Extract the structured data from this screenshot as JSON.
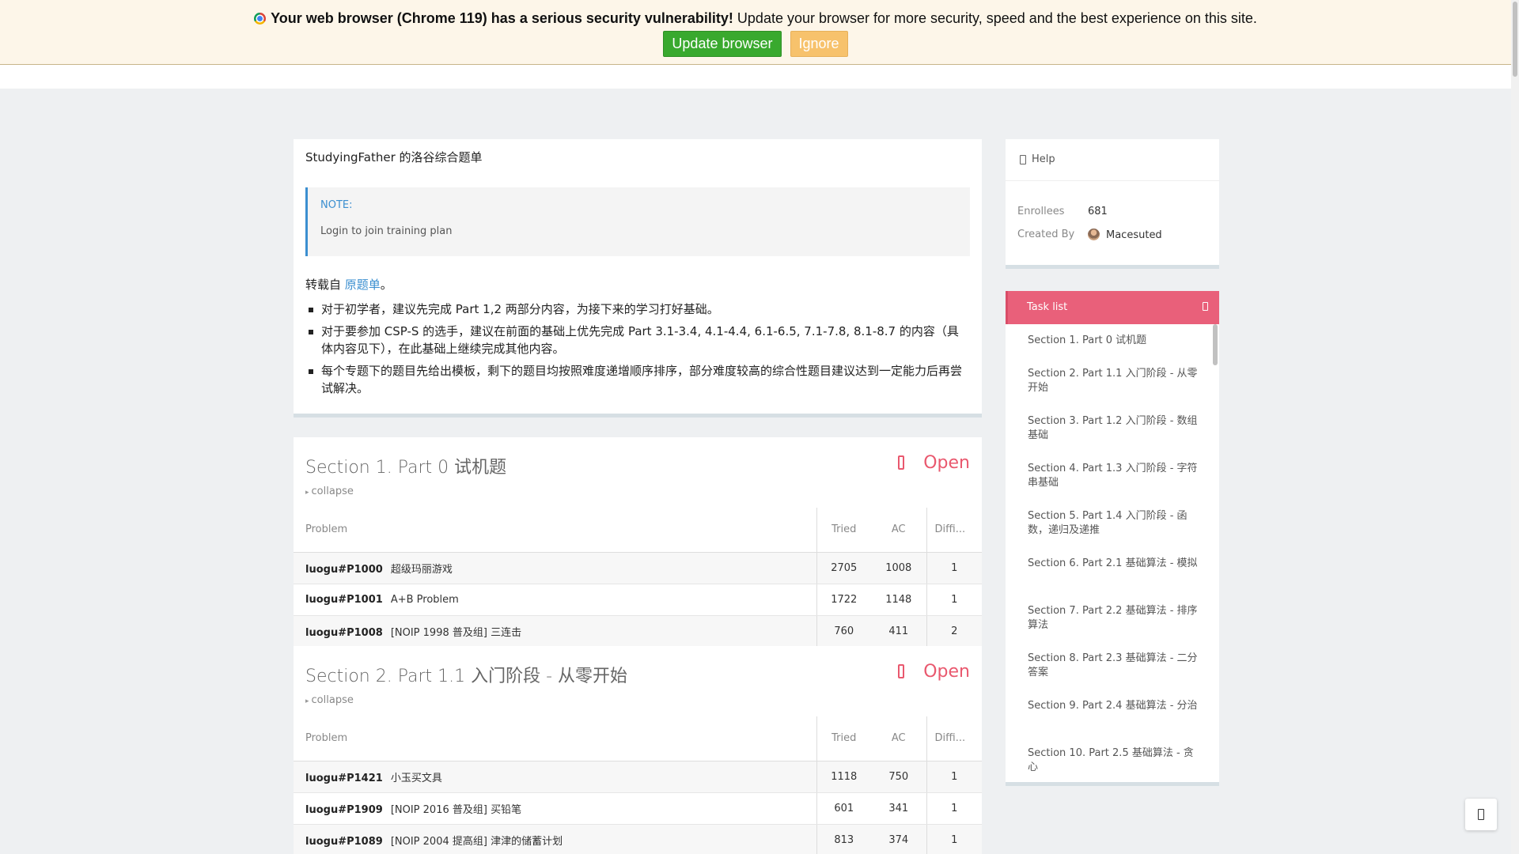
{
  "warning": {
    "strong": "Your web browser (Chrome 119) has a serious security vulnerability!",
    "text": " Update your browser for more security, speed and the best experience on this site.",
    "update_label": "Update browser",
    "ignore_label": "Ignore"
  },
  "plan": {
    "title": "StudyingFather 的洛谷综合题单",
    "note_label": "NOTE:",
    "note_text": "Login to join training plan",
    "intro_prefix": "转载自 ",
    "intro_link": "原题单",
    "intro_suffix": "。",
    "bullets": [
      "对于初学者，建议先完成 Part 1,2 两部分内容，为接下来的学习打好基础。",
      "对于要参加 CSP-S 的选手，建议在前面的基础上优先完成 Part 3.1-3.4, 4.1-4.4, 6.1-6.5, 7.1-7.8, 8.1-8.7 的内容（具体内容见下），在此基础上继续完成其他内容。",
      "每个专题下的题目先给出模板，剩下的题目均按照难度递增顺序排序，部分难度较高的综合性题目建议达到一定能力后再尝试解决。"
    ]
  },
  "table_headers": {
    "problem": "Problem",
    "tried": "Tried",
    "ac": "AC",
    "difficulty": "Diffi..."
  },
  "sections": [
    {
      "title": "Section 1. Part 0 试机题",
      "status": "Open",
      "collapse": "collapse",
      "problems": [
        {
          "id": "luogu#P1000",
          "name": "超级玛丽游戏",
          "tried": "2705",
          "ac": "1008",
          "difficulty": "1"
        },
        {
          "id": "luogu#P1001",
          "name": "A+B Problem",
          "tried": "1722",
          "ac": "1148",
          "difficulty": "1"
        },
        {
          "id": "luogu#P1008",
          "name": "[NOIP 1998 普及组] 三连击",
          "tried": "760",
          "ac": "411",
          "difficulty": "2"
        }
      ]
    },
    {
      "title": "Section 2. Part 1.1 入门阶段 - 从零开始",
      "status": "Open",
      "collapse": "collapse",
      "problems": [
        {
          "id": "luogu#P1421",
          "name": "小玉买文具",
          "tried": "1118",
          "ac": "750",
          "difficulty": "1"
        },
        {
          "id": "luogu#P1909",
          "name": "[NOIP 2016 普及组] 买铅笔",
          "tried": "601",
          "ac": "341",
          "difficulty": "1"
        },
        {
          "id": "luogu#P1089",
          "name": "[NOIP 2004 提高组] 津津的储蓄计划",
          "tried": "813",
          "ac": "374",
          "difficulty": "1"
        }
      ]
    }
  ],
  "sidebar": {
    "help_label": "Help",
    "enrollees_label": "Enrollees",
    "enrollees_value": "681",
    "created_by_label": "Created By",
    "created_by_value": "Macesuted",
    "task_list_label": "Task list",
    "tasks": [
      "Section 1. Part 0 试机题",
      "Section 2. Part 1.1 入门阶段 - 从零开始",
      "Section 3. Part 1.2 入门阶段 - 数组基础",
      "Section 4. Part 1.3 入门阶段 - 字符串基础",
      "Section 5. Part 1.4 入门阶段 - 函数，递归及递推",
      "Section 6. Part 2.1 基础算法 - 模拟",
      "Section 7. Part 2.2 基础算法 - 排序算法",
      "Section 8. Part 2.3 基础算法 - 二分答案",
      "Section 9. Part 2.4 基础算法 - 分治",
      "Section 10. Part 2.5 基础算法 - 贪心"
    ]
  },
  "colors": {
    "accent": "#e9586e",
    "link": "#3b8fd0",
    "update": "#39a92e",
    "ignore": "#f7c26c"
  },
  "icons": [
    "chrome-icon",
    "help-icon",
    "lock-icon",
    "collapse-triangle-icon",
    "avatar",
    "task-list-icon",
    "scroll-top-icon"
  ]
}
